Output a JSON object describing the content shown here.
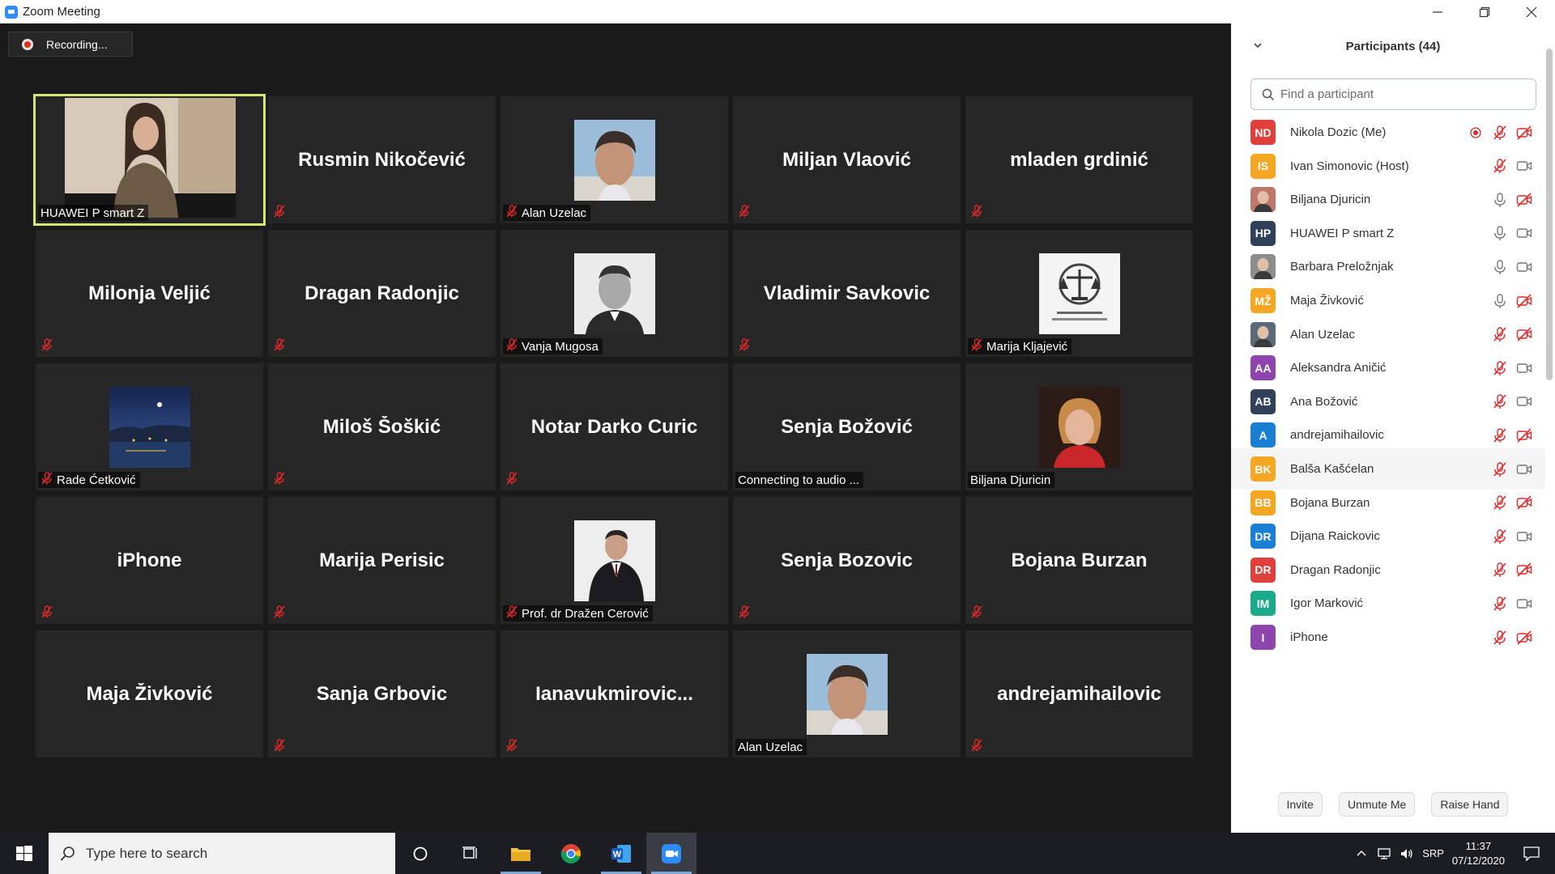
{
  "window": {
    "title": "Zoom Meeting"
  },
  "recording": {
    "label": "Recording..."
  },
  "tiles": [
    {
      "kind": "video",
      "label": "HUAWEI P smart Z",
      "speaking": true,
      "muted": false
    },
    {
      "kind": "name",
      "big": "Rusmin Nikočević",
      "label": "",
      "muted": true
    },
    {
      "kind": "photo",
      "label": "Alan Uzelac",
      "muted": true,
      "photo": "man-portrait-blue"
    },
    {
      "kind": "name",
      "big": "Miljan Vlaović",
      "label": "",
      "muted": true
    },
    {
      "kind": "name",
      "big": "mladen grdinić",
      "label": "",
      "muted": true
    },
    {
      "kind": "name",
      "big": "Milonja Veljić",
      "label": "",
      "muted": true
    },
    {
      "kind": "name",
      "big": "Dragan Radonjic",
      "label": "",
      "muted": true
    },
    {
      "kind": "photo",
      "label": "Vanja Mugosa",
      "muted": true,
      "photo": "man-portrait-bw"
    },
    {
      "kind": "name",
      "big": "Vladimir Savkovic",
      "label": "",
      "muted": true
    },
    {
      "kind": "photo",
      "label": "Marija Kljajević",
      "muted": true,
      "photo": "crest-logo"
    },
    {
      "kind": "photo",
      "label": "Rade Ćetković",
      "muted": true,
      "photo": "night-landscape"
    },
    {
      "kind": "name",
      "big": "Miloš Šoškić",
      "label": "",
      "muted": true
    },
    {
      "kind": "name",
      "big": "Notar Darko Curic",
      "label": "",
      "muted": true
    },
    {
      "kind": "name",
      "big": "Senja Božović",
      "label": "Connecting to audio ...",
      "muted": false
    },
    {
      "kind": "photo",
      "label": "Biljana Djuricin",
      "muted": false,
      "photo": "woman-portrait-red"
    },
    {
      "kind": "name",
      "big": "iPhone",
      "label": "",
      "muted": true
    },
    {
      "kind": "name",
      "big": "Marija Perisic",
      "label": "",
      "muted": true
    },
    {
      "kind": "photo",
      "label": "Prof. dr Dražen Cerović",
      "muted": true,
      "photo": "man-suit"
    },
    {
      "kind": "name",
      "big": "Senja Bozovic",
      "label": "",
      "muted": true
    },
    {
      "kind": "name",
      "big": "Bojana Burzan",
      "label": "",
      "muted": true
    },
    {
      "kind": "name",
      "big": "Maja Živković",
      "label": "",
      "muted": false
    },
    {
      "kind": "name",
      "big": "Sanja Grbovic",
      "label": "",
      "muted": true
    },
    {
      "kind": "name",
      "big": "Ianavukmirovic...",
      "label": "",
      "muted": true
    },
    {
      "kind": "photo",
      "label": "Alan Uzelac",
      "muted": false,
      "photo": "man-portrait-blue"
    },
    {
      "kind": "name",
      "big": "andrejamihailovic",
      "label": "",
      "muted": true
    }
  ],
  "panel": {
    "title": "Participants (44)",
    "search_placeholder": "Find a participant",
    "participants": [
      {
        "initials": "ND",
        "color": "#e0403b",
        "name": "Nikola Dozic (Me)",
        "recording": true,
        "mic": "muted",
        "cam": "off"
      },
      {
        "initials": "IS",
        "color": "#f5a623",
        "name": "Ivan Simonovic (Host)",
        "mic": "muted",
        "cam": "on"
      },
      {
        "initials": "",
        "color": "#c0786a",
        "name": "Biljana Djuricin",
        "mic": "on",
        "cam": "off",
        "photo": true
      },
      {
        "initials": "HP",
        "color": "#2f4058",
        "name": "HUAWEI P smart Z",
        "mic": "on",
        "cam": "on"
      },
      {
        "initials": "",
        "color": "#8c8c8c",
        "name": "Barbara Preložnjak",
        "mic": "on",
        "cam": "on",
        "photo": true
      },
      {
        "initials": "MŽ",
        "color": "#f5a623",
        "name": "Maja Živković",
        "mic": "on",
        "cam": "off"
      },
      {
        "initials": "",
        "color": "#5a6a7a",
        "name": "Alan Uzelac",
        "mic": "muted",
        "cam": "off",
        "photo": true
      },
      {
        "initials": "AA",
        "color": "#8e44ad",
        "name": "Aleksandra Aničić",
        "mic": "muted",
        "cam": "on"
      },
      {
        "initials": "AB",
        "color": "#2f4058",
        "name": "Ana Božović",
        "mic": "muted",
        "cam": "on"
      },
      {
        "initials": "A",
        "color": "#1a7fd4",
        "name": "andrejamihailovic",
        "mic": "muted",
        "cam": "off"
      },
      {
        "initials": "BK",
        "color": "#f5a623",
        "name": "Balša Kašćelan",
        "mic": "muted",
        "cam": "on",
        "hover": true
      },
      {
        "initials": "BB",
        "color": "#f5a623",
        "name": "Bojana Burzan",
        "mic": "muted",
        "cam": "off"
      },
      {
        "initials": "DR",
        "color": "#1a7fd4",
        "name": "Dijana Raickovic",
        "mic": "muted",
        "cam": "on"
      },
      {
        "initials": "DR",
        "color": "#e0403b",
        "name": "Dragan Radonjic",
        "mic": "muted",
        "cam": "off"
      },
      {
        "initials": "IM",
        "color": "#1bab8a",
        "name": "Igor Marković",
        "mic": "muted",
        "cam": "on"
      },
      {
        "initials": "I",
        "color": "#8e44ad",
        "name": "iPhone",
        "mic": "muted",
        "cam": "off"
      }
    ],
    "buttons": {
      "invite": "Invite",
      "unmute": "Unmute Me",
      "raise_hand": "Raise Hand"
    }
  },
  "taskbar": {
    "search_placeholder": "Type here to search",
    "language": "SRP",
    "time": "11:37",
    "date": "07/12/2020"
  }
}
